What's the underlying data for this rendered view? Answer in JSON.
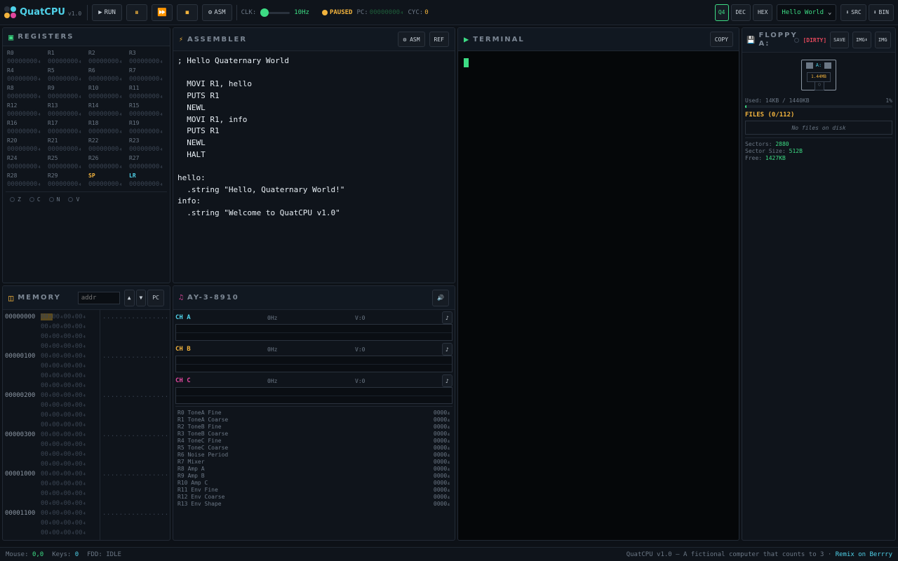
{
  "app": {
    "name": "QuatCPU",
    "version": "v1.0"
  },
  "toolbar": {
    "run": "RUN",
    "asm": "ASM",
    "clk_label": "CLK:",
    "clk_value": "10Hz",
    "state": "PAUSED",
    "pc_label": "PC:",
    "pc_value": "00000000₄",
    "cyc_label": "CYC:",
    "cyc_value": "0",
    "modes": [
      "Q4",
      "DEC",
      "HEX"
    ],
    "program": "Hello World",
    "src": "SRC",
    "bin": "BIN"
  },
  "registers": {
    "title": "REGISTERS",
    "items": [
      {
        "n": "R0",
        "v": "00000000₄"
      },
      {
        "n": "R1",
        "v": "00000000₄"
      },
      {
        "n": "R2",
        "v": "00000000₄"
      },
      {
        "n": "R3",
        "v": "00000000₄"
      },
      {
        "n": "R4",
        "v": "00000000₄"
      },
      {
        "n": "R5",
        "v": "00000000₄"
      },
      {
        "n": "R6",
        "v": "00000000₄"
      },
      {
        "n": "R7",
        "v": "00000000₄"
      },
      {
        "n": "R8",
        "v": "00000000₄"
      },
      {
        "n": "R9",
        "v": "00000000₄"
      },
      {
        "n": "R10",
        "v": "00000000₄"
      },
      {
        "n": "R11",
        "v": "00000000₄"
      },
      {
        "n": "R12",
        "v": "00000000₄"
      },
      {
        "n": "R13",
        "v": "00000000₄"
      },
      {
        "n": "R14",
        "v": "00000000₄"
      },
      {
        "n": "R15",
        "v": "00000000₄"
      },
      {
        "n": "R16",
        "v": "00000000₄"
      },
      {
        "n": "R17",
        "v": "00000000₄"
      },
      {
        "n": "R18",
        "v": "00000000₄"
      },
      {
        "n": "R19",
        "v": "00000000₄"
      },
      {
        "n": "R20",
        "v": "00000000₄"
      },
      {
        "n": "R21",
        "v": "00000000₄"
      },
      {
        "n": "R22",
        "v": "00000000₄"
      },
      {
        "n": "R23",
        "v": "00000000₄"
      },
      {
        "n": "R24",
        "v": "00000000₄"
      },
      {
        "n": "R25",
        "v": "00000000₄"
      },
      {
        "n": "R26",
        "v": "00000000₄"
      },
      {
        "n": "R27",
        "v": "00000000₄"
      },
      {
        "n": "R28",
        "v": "00000000₄"
      },
      {
        "n": "R29",
        "v": "00000000₄"
      },
      {
        "n": "SP",
        "v": "00000000₄"
      },
      {
        "n": "LR",
        "v": "00000000₄"
      }
    ],
    "flags": [
      "Z",
      "C",
      "N",
      "V"
    ]
  },
  "assembler": {
    "title": "ASSEMBLER",
    "asm_btn": "ASM",
    "ref_btn": "REF",
    "source": "; Hello Quaternary World\n\n  MOVI R1, hello\n  PUTS R1\n  NEWL\n  MOVI R1, info\n  PUTS R1\n  NEWL\n  HALT\n\nhello:\n  .string \"Hello, Quaternary World!\"\ninfo:\n  .string \"Welcome to QuatCPU v1.0\""
  },
  "terminal": {
    "title": "TERMINAL",
    "copy_btn": "COPY"
  },
  "floppy": {
    "title": "FLOPPY A:",
    "dirty": "[DIRTY]",
    "save": "SAVE",
    "img_in": "IMG⬇",
    "img_out": "IMG",
    "disk_label": "A:",
    "disk_size": "1.44MB",
    "used": "Used: 14KB / 1440KB",
    "used_pct": "1%",
    "used_frac": 0.01,
    "files_title": "FILES (0/112)",
    "empty": "No files on disk",
    "sectors_label": "Sectors:",
    "sectors": "2880",
    "sector_size_label": "Sector Size:",
    "sector_size": "512B",
    "free_label": "Free:",
    "free": "1427KB"
  },
  "memory": {
    "title": "MEMORY",
    "placeholder": "addr",
    "pc_btn": "PC",
    "rows": [
      {
        "a": "00000000",
        "b": "00₄00₄00₄00₄",
        "s": "................"
      },
      {
        "a": "",
        "b": "00₄00₄00₄00₄",
        "s": ""
      },
      {
        "a": "",
        "b": "00₄00₄00₄00₄",
        "s": ""
      },
      {
        "a": "",
        "b": "00₄00₄00₄00₄",
        "s": ""
      },
      {
        "a": "00000100",
        "b": "00₄00₄00₄00₄",
        "s": "................"
      },
      {
        "a": "",
        "b": "00₄00₄00₄00₄",
        "s": ""
      },
      {
        "a": "",
        "b": "00₄00₄00₄00₄",
        "s": ""
      },
      {
        "a": "",
        "b": "00₄00₄00₄00₄",
        "s": ""
      },
      {
        "a": "00000200",
        "b": "00₄00₄00₄00₄",
        "s": "................"
      },
      {
        "a": "",
        "b": "00₄00₄00₄00₄",
        "s": ""
      },
      {
        "a": "",
        "b": "00₄00₄00₄00₄",
        "s": ""
      },
      {
        "a": "",
        "b": "00₄00₄00₄00₄",
        "s": ""
      },
      {
        "a": "00000300",
        "b": "00₄00₄00₄00₄",
        "s": "................"
      },
      {
        "a": "",
        "b": "00₄00₄00₄00₄",
        "s": ""
      },
      {
        "a": "",
        "b": "00₄00₄00₄00₄",
        "s": ""
      },
      {
        "a": "",
        "b": "00₄00₄00₄00₄",
        "s": ""
      },
      {
        "a": "00001000",
        "b": "00₄00₄00₄00₄",
        "s": "................"
      },
      {
        "a": "",
        "b": "00₄00₄00₄00₄",
        "s": ""
      },
      {
        "a": "",
        "b": "00₄00₄00₄00₄",
        "s": ""
      },
      {
        "a": "",
        "b": "00₄00₄00₄00₄",
        "s": ""
      },
      {
        "a": "00001100",
        "b": "00₄00₄00₄00₄",
        "s": "................"
      },
      {
        "a": "",
        "b": "00₄00₄00₄00₄",
        "s": ""
      },
      {
        "a": "",
        "b": "00₄00₄00₄00₄",
        "s": ""
      }
    ]
  },
  "ay": {
    "title": "AY-3-8910",
    "channels": [
      {
        "name": "CH A",
        "freq": "0Hz",
        "vol": "V:0",
        "color": "#4fd1e8"
      },
      {
        "name": "CH B",
        "freq": "0Hz",
        "vol": "V:0",
        "color": "#f2b33d"
      },
      {
        "name": "CH C",
        "freq": "0Hz",
        "vol": "V:0",
        "color": "#e0479e"
      }
    ],
    "regs": [
      {
        "n": "R0 ToneA Fine",
        "v": "0000₄"
      },
      {
        "n": "R1 ToneA Coarse",
        "v": "0000₄"
      },
      {
        "n": "R2 ToneB Fine",
        "v": "0000₄"
      },
      {
        "n": "R3 ToneB Coarse",
        "v": "0000₄"
      },
      {
        "n": "R4 ToneC Fine",
        "v": "0000₄"
      },
      {
        "n": "R5 ToneC Coarse",
        "v": "0000₄"
      },
      {
        "n": "R6 Noise Period",
        "v": "0000₄"
      },
      {
        "n": "R7 Mixer",
        "v": "0000₄"
      },
      {
        "n": "R8 Amp A",
        "v": "0000₄"
      },
      {
        "n": "R9 Amp B",
        "v": "0000₄"
      },
      {
        "n": "R10 Amp C",
        "v": "0000₄"
      },
      {
        "n": "R11 Env Fine",
        "v": "0000₄"
      },
      {
        "n": "R12 Env Coarse",
        "v": "0000₄"
      },
      {
        "n": "R13 Env Shape",
        "v": "0000₄"
      }
    ]
  },
  "status": {
    "mouse_label": "Mouse:",
    "mouse": "0,0",
    "keys_label": "Keys:",
    "keys": "0",
    "fdd": "FDD: IDLE",
    "tagline": "QuatCPU v1.0 — A fictional computer that counts to 3 ·",
    "remix": "Remix on Berrry"
  }
}
